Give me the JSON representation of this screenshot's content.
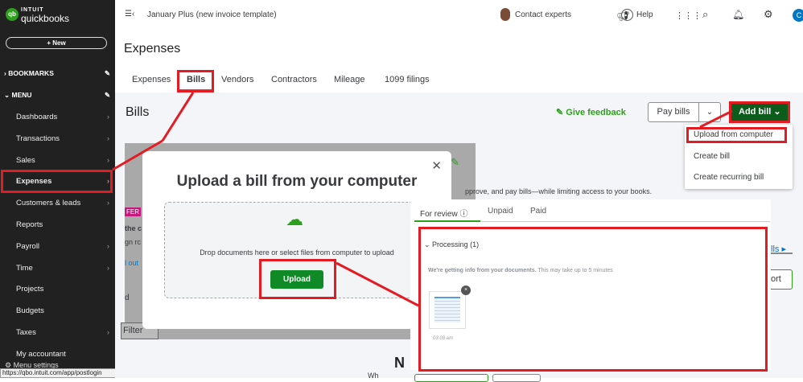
{
  "sidebar": {
    "brand_top": "INTUIT",
    "brand": "quickbooks",
    "logo": "qb",
    "new_button": "+ New",
    "bookmarks": "BOOKMARKS",
    "menu": "MENU",
    "items": [
      {
        "label": "Dashboards",
        "chev": true
      },
      {
        "label": "Transactions",
        "chev": true
      },
      {
        "label": "Sales",
        "chev": true
      },
      {
        "label": "Expenses",
        "chev": true
      },
      {
        "label": "Customers & leads",
        "chev": true
      },
      {
        "label": "Reports",
        "chev": false
      },
      {
        "label": "Payroll",
        "chev": true
      },
      {
        "label": "Time",
        "chev": true
      },
      {
        "label": "Projects",
        "chev": false
      },
      {
        "label": "Budgets",
        "chev": false
      },
      {
        "label": "Taxes",
        "chev": true
      },
      {
        "label": "My accountant",
        "chev": false
      }
    ],
    "menu_settings": "Menu settings",
    "status_url": "https://qbo.intuit.com/app/postlogin"
  },
  "topbar": {
    "company": "January Plus (new invoice template)",
    "contact": "Contact experts",
    "help": "Help",
    "avatar": "C"
  },
  "page": {
    "title": "Expenses",
    "tabs": [
      "Expenses",
      "Bills",
      "Vendors",
      "Contractors",
      "Mileage",
      "1099 filings"
    ],
    "active_tab": "Bills",
    "section_title": "Bills",
    "feedback": "Give feedback",
    "pay_bills": "Pay bills",
    "add_bill": "Add bill",
    "bg_desc": "pprove, and pay bills—while limiting access to your books.",
    "bg_badge": "FER",
    "bg_t1": "the c",
    "bg_t2": "gn rc",
    "bg_link": "l out",
    "bg_t3": "d",
    "filter": "Filter",
    "bg_n": "N",
    "bg_wh": "Wh",
    "right_link": "lls ▸",
    "right_btn": "ort"
  },
  "add_menu": {
    "items": [
      "Upload from computer",
      "Create bill",
      "Create recurring bill"
    ]
  },
  "modal": {
    "title": "Upload a bill from your computer",
    "drop_text": "Drop documents here or select files from computer to upload",
    "upload": "Upload"
  },
  "review": {
    "tabs": [
      "For review",
      "Unpaid",
      "Paid"
    ],
    "processing": "Processing (1)",
    "info_bold": "We're getting info from your documents.",
    "info": " This may take up to 5 minutes",
    "time": "03:03 am"
  },
  "colors": {
    "accent": "#2ca01c",
    "dark_green": "#0d5c1b",
    "annotation": "#e31b23"
  }
}
